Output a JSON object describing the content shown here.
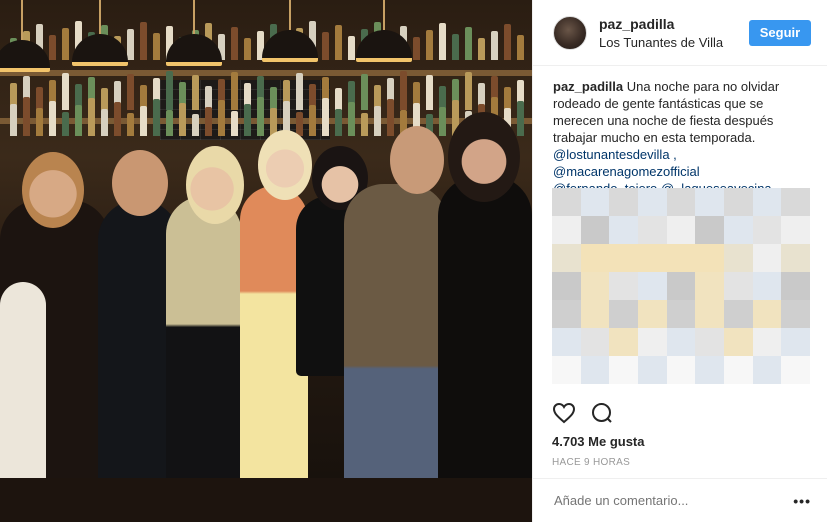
{
  "post": {
    "image_alt": "Group photo in a bar",
    "header": {
      "username": "paz_padilla",
      "location": "Los Tunantes de Villa",
      "follow_label": "Seguir"
    },
    "caption": {
      "username": "paz_padilla",
      "text": "Una noche para no olvidar rodeado de gente fantásticas que se merecen una noche de fiesta después trabajar mucho en esta temporada.",
      "mention_1": "@lostunantesdevilla ,",
      "mention_2": "@macarenagomezofficial",
      "mention_3": "@fernando_tejero @_laqueseavecina"
    },
    "likes": "4.703 Me gusta",
    "time": "HACE 9 HORAS",
    "comment_placeholder": "Añade un comentario...",
    "more_icon": "more-options-icon",
    "colors": {
      "accent": "#3897f0",
      "mention": "#003569",
      "border": "#efefef",
      "muted": "#999999"
    }
  }
}
